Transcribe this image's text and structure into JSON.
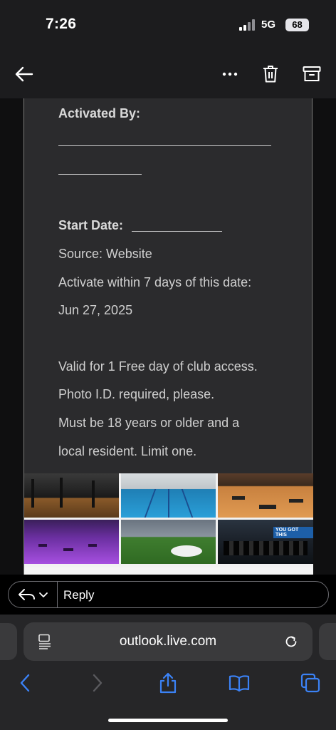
{
  "status_bar": {
    "time": "7:26",
    "network": "5G",
    "battery_level": "68"
  },
  "app_bar": {
    "back_icon": "arrow-left-icon",
    "more_icon": "more-dots-icon",
    "delete_icon": "trash-icon",
    "archive_icon": "archive-icon"
  },
  "email": {
    "activated_by_label": "Activated By:",
    "start_date_label": "Start Date:",
    "source": "Source: Website",
    "activate_within": "Activate within 7 days of this date:",
    "date": "Jun 27, 2025",
    "valid_line": "Valid for 1 Free day of club access.",
    "photo_id_line": "Photo I.D. required, please.",
    "age_line_1": "Must be 18 years or older and a",
    "age_line_2": "local resident. Limit one.",
    "photo_banner_text": "YOU GOT THIS"
  },
  "reply_bar": {
    "reply_label": "Reply",
    "reply_icon": "reply-arrow-icon"
  },
  "browser": {
    "url": "outlook.live.com",
    "reader_icon": "reader-mode-icon",
    "reload_icon": "reload-icon",
    "toolbar_icons": [
      "back-icon",
      "forward-icon",
      "share-icon",
      "bookmarks-icon",
      "tabs-icon"
    ],
    "accent_color": "#3b82f6"
  }
}
